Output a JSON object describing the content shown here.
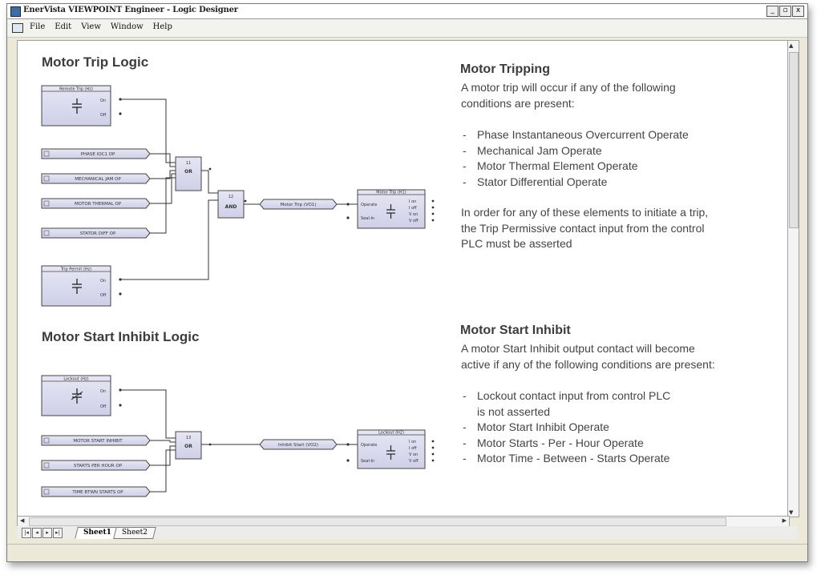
{
  "window": {
    "title": "EnerVista VIEWPOINT Engineer - Logic Designer",
    "controls": [
      "_",
      "▫",
      "x"
    ]
  },
  "menu": {
    "items": [
      "File",
      "Edit",
      "View",
      "Window",
      "Help"
    ]
  },
  "diagram_trip": {
    "title": "Motor Trip Logic",
    "input1": {
      "header": "Remote Trip (Hz)",
      "on": "On",
      "off": "Off"
    },
    "input2": {
      "header": "Trip Permit (Hz)",
      "on": "On",
      "off": "Off"
    },
    "operands": [
      "PHASE IOC1 OP",
      "MECHANICAL JAM OP",
      "MOTOR THERMAL OP",
      "STATOR DIFF OP"
    ],
    "or_gate": {
      "number": "11",
      "label": "OR"
    },
    "and_gate": {
      "number": "12",
      "label": "AND"
    },
    "virtual_output": "Motor Trip (VO1)",
    "output": {
      "header": "Motor Trip (H1)",
      "operate": "Operate",
      "seal_in": "Seal-In",
      "ports": [
        "I on",
        "I off",
        "V on",
        "V off"
      ]
    }
  },
  "diagram_inhibit": {
    "title": "Motor Start Inhibit Logic",
    "input1": {
      "header": "Lockout (Hz)",
      "on": "On",
      "off": "Off"
    },
    "operands": [
      "MOTOR START INHIBIT",
      "STARTS PER HOUR OP",
      "TIME BTWN STARTS OP"
    ],
    "or_gate": {
      "number": "13",
      "label": "OR"
    },
    "virtual_output": "Inhibit Start (VO2)",
    "output": {
      "header": "Lockout (H2)",
      "operate": "Operate",
      "seal_in": "Seal-In",
      "ports": [
        "I on",
        "I off",
        "V on",
        "V off"
      ]
    }
  },
  "desc_trip": {
    "title": "Motor Tripping",
    "intro_lines": [
      "A motor trip will occur if any of the following",
      "conditions are present:"
    ],
    "bullets": [
      "Phase Instantaneous Overcurrent Operate",
      "Mechanical Jam Operate",
      "Motor Thermal Element Operate",
      "Stator Differential Operate"
    ],
    "note_lines": [
      "In order for any of these elements to initiate a trip,",
      "the Trip Permissive contact input from the control",
      "PLC must be asserted"
    ]
  },
  "desc_inhibit": {
    "title": "Motor Start Inhibit",
    "intro_lines": [
      "A motor Start Inhibit output contact will become",
      "active if any of the following conditions are present:"
    ],
    "bullets": [
      "Lockout contact input from control PLC",
      "is not asserted",
      "Motor Start Inhibit Operate",
      "Motor Starts - Per - Hour Operate",
      "Motor Time - Between - Starts Operate"
    ]
  },
  "tabs": {
    "nav": [
      "|◂",
      "◂",
      "▸",
      "▸|"
    ],
    "sheet1": "Sheet1",
    "sheet2": "Sheet2"
  }
}
